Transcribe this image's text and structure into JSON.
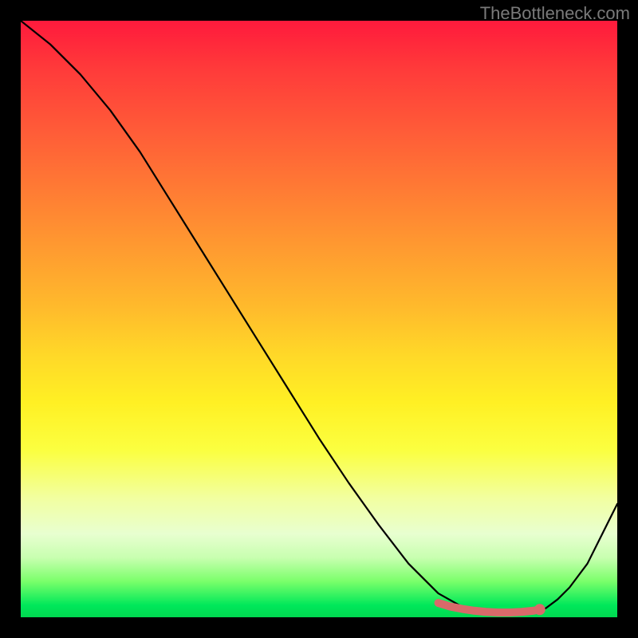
{
  "watermark": "TheBottleneck.com",
  "chart_data": {
    "type": "line",
    "title": "",
    "xlabel": "",
    "ylabel": "",
    "xlim": [
      0,
      100
    ],
    "ylim": [
      0,
      100
    ],
    "series": [
      {
        "name": "bottleneck-curve",
        "x": [
          0,
          5,
          10,
          15,
          20,
          25,
          30,
          35,
          40,
          45,
          50,
          55,
          60,
          65,
          70,
          75,
          78,
          80,
          82,
          85,
          88,
          90,
          92,
          95,
          100
        ],
        "y": [
          100,
          96,
          91,
          85,
          78,
          70,
          62,
          54,
          46,
          38,
          30,
          22.5,
          15.5,
          9,
          4,
          1.2,
          0.6,
          0.5,
          0.5,
          0.6,
          1.5,
          3,
          5,
          9,
          19
        ]
      }
    ],
    "highlight": {
      "name": "optimal-range",
      "points": [
        {
          "x": 70,
          "y": 2.4
        },
        {
          "x": 72,
          "y": 1.8
        },
        {
          "x": 74,
          "y": 1.4
        },
        {
          "x": 76,
          "y": 1.1
        },
        {
          "x": 78,
          "y": 0.9
        },
        {
          "x": 80,
          "y": 0.8
        },
        {
          "x": 82,
          "y": 0.8
        },
        {
          "x": 84,
          "y": 0.9
        },
        {
          "x": 85,
          "y": 1.0
        },
        {
          "x": 86,
          "y": 1.1
        },
        {
          "x": 87,
          "y": 1.3
        }
      ],
      "marker_x": 87,
      "marker_y": 1.3
    },
    "gradient_stops": [
      {
        "pos": 0,
        "color": "#ff1a3c"
      },
      {
        "pos": 50,
        "color": "#ffd828"
      },
      {
        "pos": 80,
        "color": "#f2ffa0"
      },
      {
        "pos": 100,
        "color": "#00d850"
      }
    ]
  }
}
